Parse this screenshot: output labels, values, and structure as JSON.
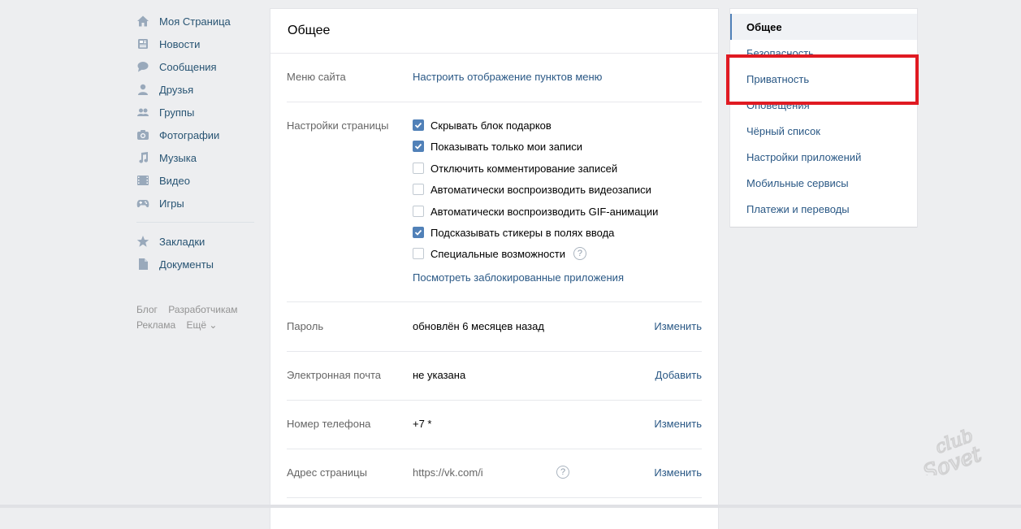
{
  "left_nav": {
    "items": [
      {
        "label": "Моя Страница",
        "icon": "home-icon"
      },
      {
        "label": "Новости",
        "icon": "news-icon"
      },
      {
        "label": "Сообщения",
        "icon": "messages-icon"
      },
      {
        "label": "Друзья",
        "icon": "friends-icon"
      },
      {
        "label": "Группы",
        "icon": "groups-icon"
      },
      {
        "label": "Фотографии",
        "icon": "camera-icon"
      },
      {
        "label": "Музыка",
        "icon": "music-icon"
      },
      {
        "label": "Видео",
        "icon": "video-icon"
      },
      {
        "label": "Игры",
        "icon": "gamepad-icon"
      }
    ],
    "extra_items": [
      {
        "label": "Закладки",
        "icon": "star-icon"
      },
      {
        "label": "Документы",
        "icon": "document-icon"
      }
    ],
    "footer": {
      "blog": "Блог",
      "developers": "Разработчикам",
      "ads": "Реклама",
      "more": "Ещё ⌄"
    }
  },
  "main": {
    "title": "Общее",
    "menu": {
      "label": "Меню сайта",
      "link": "Настроить отображение пунктов меню"
    },
    "page_settings": {
      "label": "Настройки страницы",
      "options": [
        {
          "label": "Скрывать блок подарков",
          "checked": true
        },
        {
          "label": "Показывать только мои записи",
          "checked": true
        },
        {
          "label": "Отключить комментирование записей",
          "checked": false
        },
        {
          "label": "Автоматически воспроизводить видеозаписи",
          "checked": false
        },
        {
          "label": "Автоматически воспроизводить GIF-анимации",
          "checked": false
        },
        {
          "label": "Подсказывать стикеры в полях ввода",
          "checked": true
        },
        {
          "label": "Специальные возможности",
          "checked": false
        }
      ],
      "help_mark": "?",
      "blocked_apps_link": "Посмотреть заблокированные приложения"
    },
    "password": {
      "label": "Пароль",
      "value": "обновлён 6 месяцев назад",
      "action": "Изменить"
    },
    "email": {
      "label": "Электронная почта",
      "value": "не указана",
      "action": "Добавить"
    },
    "phone": {
      "label": "Номер телефона",
      "value": "+7 *",
      "action": "Изменить"
    },
    "address": {
      "label": "Адрес страницы",
      "value": "https://vk.com/i",
      "help_mark": "?",
      "action": "Изменить"
    }
  },
  "right_menu": {
    "items": [
      {
        "label": "Общее",
        "active": true
      },
      {
        "label": "Безопасность",
        "active": false
      },
      {
        "label": "Приватность",
        "active": false
      },
      {
        "label": "Оповещения",
        "active": false
      },
      {
        "label": "Чёрный список",
        "active": false
      },
      {
        "label": "Настройки приложений",
        "active": false
      },
      {
        "label": "Мобильные сервисы",
        "active": false
      },
      {
        "label": "Платежи и переводы",
        "active": false
      }
    ]
  },
  "colors": {
    "background": "#edeef0",
    "link": "#2a5885",
    "checkbox_on": "#5181b8",
    "highlight": "#e01a22"
  }
}
